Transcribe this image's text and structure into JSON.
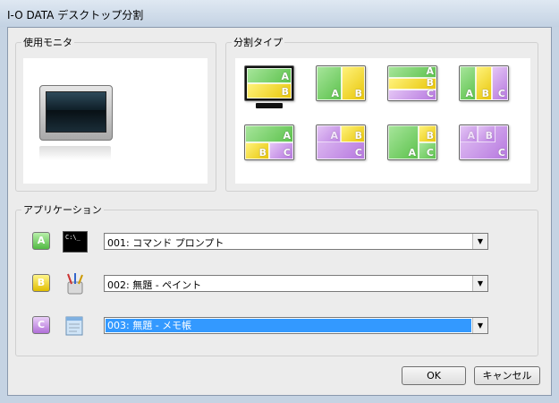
{
  "window": {
    "title": "I-O DATA デスクトップ分割"
  },
  "monitor_group": {
    "label": "使用モニタ"
  },
  "split_group": {
    "label": "分割タイプ",
    "options": [
      {
        "name": "split-type-ab-horizontal",
        "selected": true
      },
      {
        "name": "split-type-ab-vertical"
      },
      {
        "name": "split-type-abc-rows"
      },
      {
        "name": "split-type-abc-columns"
      },
      {
        "name": "split-type-a-top-bc-bottom"
      },
      {
        "name": "split-type-ab-left-c-right"
      },
      {
        "name": "split-type-a-left-bc-right"
      },
      {
        "name": "split-type-diagonal-abc"
      }
    ],
    "segment_labels": {
      "a": "A",
      "b": "B",
      "c": "C"
    }
  },
  "app_group": {
    "label": "アプリケーション",
    "rows": [
      {
        "badge": "A",
        "icon": "command-prompt-icon",
        "value": "001: コマンド プロンプト",
        "selected": false
      },
      {
        "badge": "B",
        "icon": "paint-icon",
        "value": "002: 無題 - ペイント",
        "selected": false
      },
      {
        "badge": "C",
        "icon": "notepad-icon",
        "value": "003: 無題 - メモ帳",
        "selected": true
      }
    ]
  },
  "buttons": {
    "ok": "OK",
    "cancel": "キャンセル"
  },
  "colors": {
    "a": "#5dc24d",
    "b": "#e8c60a",
    "c": "#b678df",
    "selection": "#3399ff"
  }
}
